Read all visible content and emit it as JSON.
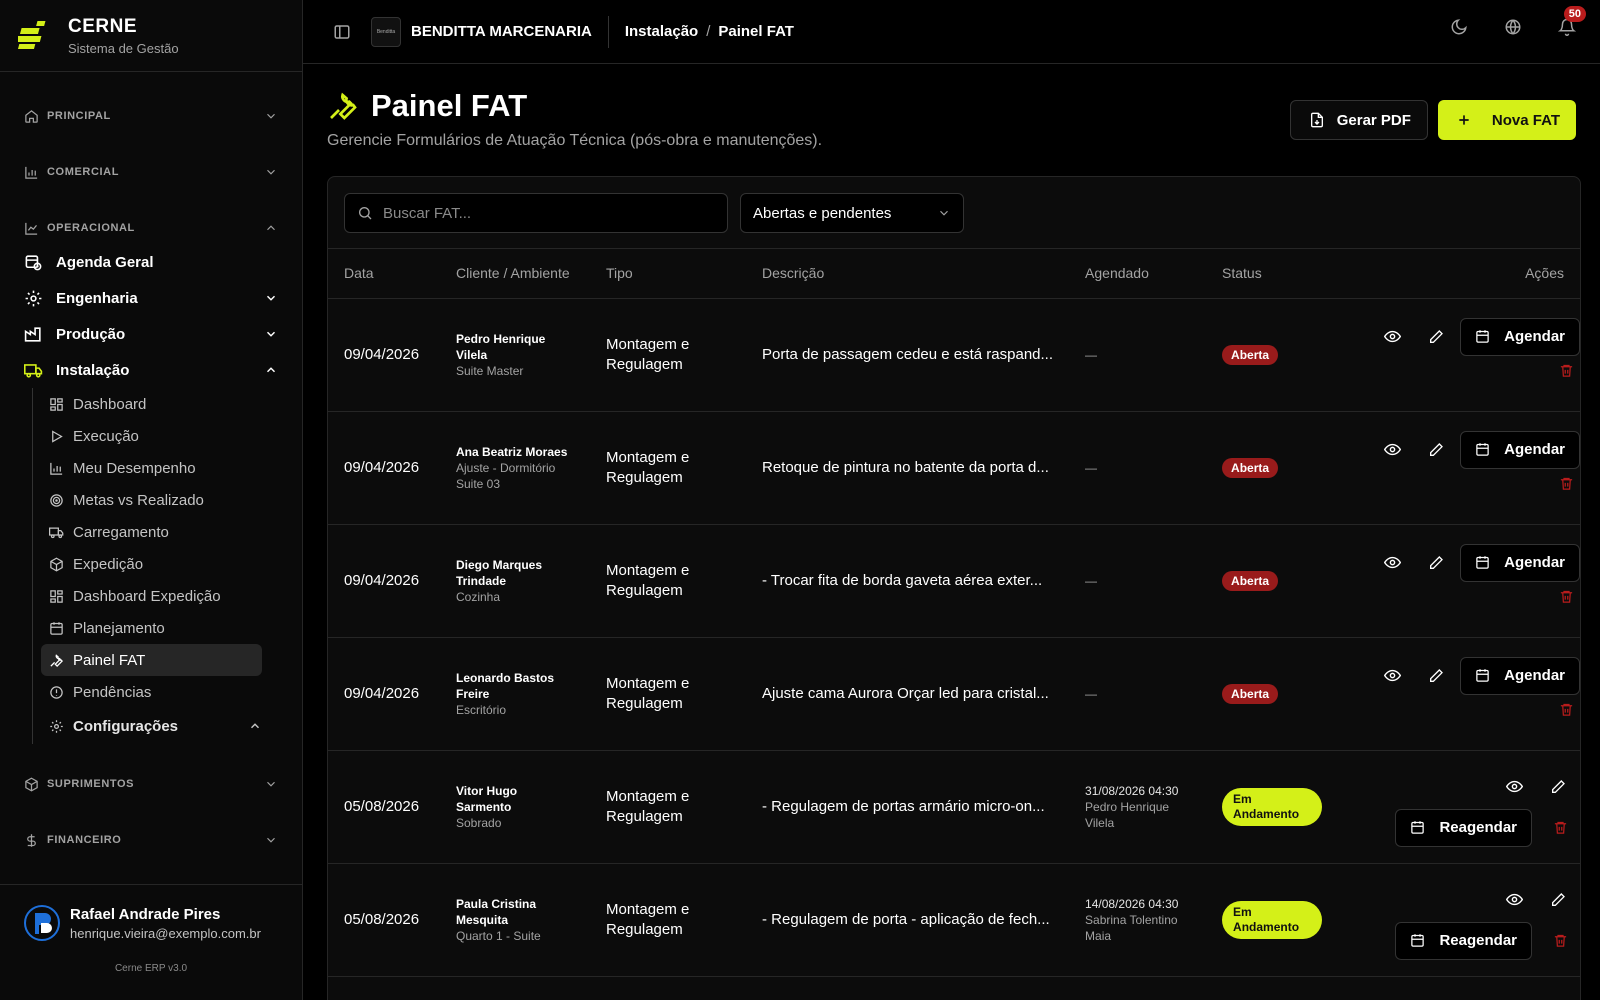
{
  "brand": {
    "name": "CERNE",
    "subtitle": "Sistema de Gestão"
  },
  "sidebar": {
    "sections": {
      "principal": "PRINCIPAL",
      "comercial": "COMERCIAL",
      "operacional": "OPERACIONAL",
      "suprimentos": "SUPRIMENTOS",
      "financeiro": "FINANCEIRO"
    },
    "operacional_items": {
      "agenda": "Agenda Geral",
      "engenharia": "Engenharia",
      "producao": "Produção",
      "instalacao": "Instalação"
    },
    "instalacao_sub": [
      "Dashboard",
      "Execução",
      "Meu Desempenho",
      "Metas vs Realizado",
      "Carregamento",
      "Expedição",
      "Dashboard Expedição",
      "Planejamento",
      "Painel FAT",
      "Pendências",
      "Configurações"
    ],
    "active_item": "Painel FAT"
  },
  "user": {
    "name": "Rafael Andrade Pires",
    "email": "henrique.vieira@exemplo.com.br"
  },
  "version": "Cerne ERP v3.0",
  "topbar": {
    "company": "BENDITTA MARCENARIA",
    "company_logo_text": "Benditta",
    "breadcrumb": [
      "Instalação",
      "Painel FAT"
    ],
    "breadcrumb_sep": "/",
    "notifications": "50"
  },
  "page": {
    "title": "Painel FAT",
    "subtitle": "Gerencie Formulários de Atuação Técnica (pós-obra e manutenções).",
    "btn_pdf": "Gerar PDF",
    "btn_new": "Nova FAT"
  },
  "filters": {
    "search_placeholder": "Buscar FAT...",
    "status_filter": "Abertas e pendentes"
  },
  "table": {
    "columns": [
      "Data",
      "Cliente / Ambiente",
      "Tipo",
      "Descrição",
      "Agendado",
      "Status",
      "Ações"
    ],
    "rows": [
      {
        "date": "09/04/2026",
        "client": "Pedro Henrique Vilela",
        "env": "Suite Master",
        "tipo": "Montagem e Regulagem",
        "desc": "Porta de passagem cedeu e está raspand...",
        "ag_date": "",
        "ag_person": "—",
        "status": "Aberta",
        "action": "Agendar"
      },
      {
        "date": "09/04/2026",
        "client": "Ana Beatriz Moraes",
        "env": "Ajuste - Dormitório Suite 03",
        "tipo": "Montagem e Regulagem",
        "desc": "Retoque de pintura no batente da porta d...",
        "ag_date": "",
        "ag_person": "—",
        "status": "Aberta",
        "action": "Agendar"
      },
      {
        "date": "09/04/2026",
        "client": "Diego Marques Trindade",
        "env": "Cozinha",
        "tipo": "Montagem e Regulagem",
        "desc": "- Trocar fita de borda gaveta aérea exter...",
        "ag_date": "",
        "ag_person": "—",
        "status": "Aberta",
        "action": "Agendar"
      },
      {
        "date": "09/04/2026",
        "client": "Leonardo Bastos Freire",
        "env": "Escritório",
        "tipo": "Montagem e Regulagem",
        "desc": "Ajuste cama Aurora Orçar led para cristal...",
        "ag_date": "",
        "ag_person": "—",
        "status": "Aberta",
        "action": "Agendar"
      },
      {
        "date": "05/08/2026",
        "client": "Vitor Hugo Sarmento",
        "env": "Sobrado",
        "tipo": "Montagem e Regulagem",
        "desc": "- Regulagem de portas armário micro-on...",
        "ag_date": "31/08/2026 04:30",
        "ag_person": "Pedro Henrique Vilela",
        "status": "Em Andamento",
        "action": "Reagendar"
      },
      {
        "date": "05/08/2026",
        "client": "Paula Cristina Mesquita",
        "env": "Quarto 1 - Suite",
        "tipo": "Montagem e Regulagem",
        "desc": "- Regulagem de porta - aplicação de fech...",
        "ag_date": "14/08/2026 04:30",
        "ag_person": "Sabrina Tolentino Maia",
        "status": "Em Andamento",
        "action": "Reagendar"
      }
    ]
  },
  "colors": {
    "accent": "#d4f018",
    "danger": "#991b1b",
    "background": "#000000"
  },
  "icons": [
    "logo-icon",
    "home-icon",
    "chart-icon",
    "agenda-icon",
    "gear-icon",
    "factory-icon",
    "truck-icon",
    "wrench-icon",
    "eye-icon",
    "pencil-icon",
    "calendar-icon",
    "trash-icon",
    "moon-icon",
    "globe-icon",
    "bell-icon",
    "search-icon",
    "file-download-icon",
    "plus-icon"
  ]
}
